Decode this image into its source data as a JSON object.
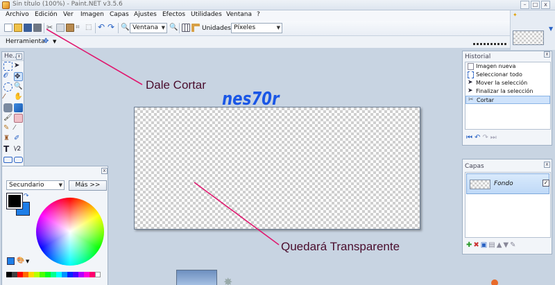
{
  "window": {
    "title": "Sin título (100%) - Paint.NET v3.5.6",
    "minimize": "–",
    "maximize": "□",
    "close": "x"
  },
  "menu": [
    "Archivo",
    "Edición",
    "Ver",
    "Imagen",
    "Capas",
    "Ajustes",
    "Efectos",
    "Utilidades",
    "Ventana",
    "?"
  ],
  "toolbar": {
    "zoom_value": "Ventana",
    "units_label": "Unidades:",
    "units_value": "Píxeles"
  },
  "toolbar2": {
    "tool_label": "Herramienta:"
  },
  "tools_panel": {
    "title": "He...",
    "close": "x"
  },
  "history": {
    "title": "Historial",
    "close": "x",
    "items": [
      "Imagen nueva",
      "Seleccionar todo",
      "Mover la selección",
      "Finalizar la selección",
      "Cortar"
    ],
    "selected_index": 4
  },
  "layers": {
    "title": "Capas",
    "close": "x",
    "items": [
      {
        "name": "Fondo",
        "visible": true
      }
    ]
  },
  "colors_panel": {
    "mode": "Secundario",
    "more_button": "Más >>",
    "close": "x",
    "primary_color": "#000000",
    "secondary_color": "#1e7ee8"
  },
  "annotations": {
    "cut": "Dale Cortar",
    "transparent": "Quedará Transparente",
    "watermark": "nes70r"
  },
  "colors": {
    "arrow": "#e0186f",
    "selected_row": "#cfe3fb",
    "accent": "#1a56e6"
  }
}
